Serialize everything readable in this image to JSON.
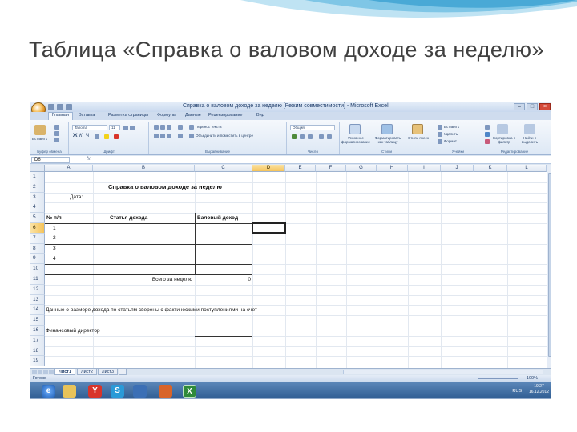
{
  "slide": {
    "title": "Таблица «Справка о валовом доходе за неделю»"
  },
  "window": {
    "title": "Справка о валовом доходе за неделю  [Режим совместимости] - Microsoft Excel"
  },
  "ribbon_tabs": [
    "Главная",
    "Вставка",
    "Разметка страницы",
    "Формулы",
    "Данные",
    "Рецензирование",
    "Вид"
  ],
  "ribbon": {
    "paste": "Вставить",
    "font_name": "Tahoma",
    "font_size": "11",
    "wrap_text": "Перенос текста",
    "merge_center": "Объединить и поместить в центре",
    "number_format": "Общий",
    "conditional_format": "Условное форматирование",
    "format_as_table": "Форматировать как таблицу",
    "cell_styles": "Стили ячеек",
    "insert": "Вставить",
    "delete": "Удалить",
    "format": "Формат",
    "sort_filter": "Сортировка и фильтр",
    "find_select": "Найти и выделить",
    "groups": [
      "Буфер обмена",
      "Шрифт",
      "Выравнивание",
      "Число",
      "Стили",
      "Ячейки",
      "Редактирование"
    ]
  },
  "formula_bar": {
    "name_box": "D6",
    "fx": "fx",
    "value": ""
  },
  "columns": [
    "A",
    "B",
    "C",
    "D",
    "E",
    "F",
    "G",
    "H",
    "I",
    "J",
    "K",
    "L"
  ],
  "selected_column": "D",
  "rows": [
    "1",
    "2",
    "3",
    "4",
    "5",
    "6",
    "7",
    "8",
    "9",
    "10",
    "11",
    "12",
    "13",
    "14",
    "15",
    "16",
    "17",
    "18",
    "19"
  ],
  "selected_row": "6",
  "sheet": {
    "heading": "Справка о валовом доходе за неделю",
    "date_label": "Дата:",
    "col_num": "№ п/п",
    "col_article": "Статья дохода",
    "col_income": "Валовый доход",
    "items": [
      "1",
      "2",
      "3",
      "4"
    ],
    "total_label": "Всего за неделю",
    "total_value": "0",
    "note": "Данные о размере дохода по статьям сверены с фактическими поступлениями на счет",
    "signature_label": "Финансовый директор"
  },
  "sheet_tabs": [
    "Лист1",
    "Лист2",
    "Лист3"
  ],
  "active_sheet": "Лист1",
  "status": {
    "ready": "Готово",
    "zoom": "100%"
  },
  "taskbar": {
    "language": "RUS",
    "time": "19:27",
    "date": "16.12.2012"
  }
}
